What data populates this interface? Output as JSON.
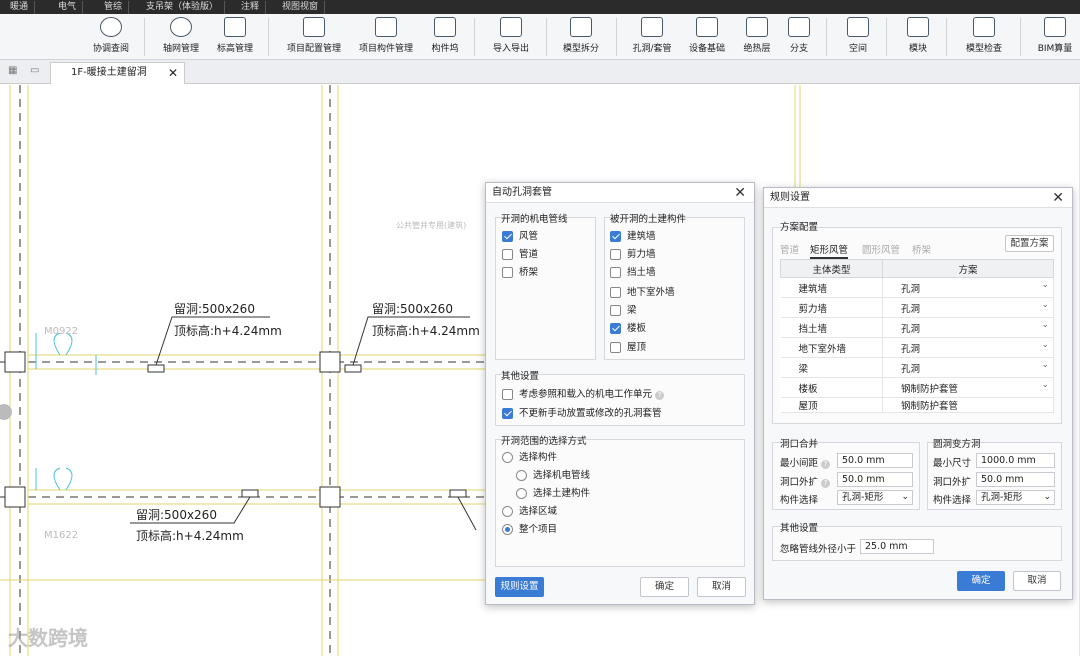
{
  "ribbon_tabs": [
    "暖通",
    "电气",
    "管综",
    "支吊架（体验版）",
    "注释",
    "视图视窗"
  ],
  "toolbar": [
    {
      "label": "协调查阅",
      "icon": "magnifier-icon"
    },
    {
      "label": "轴网管理",
      "icon": "axis-circle-icon"
    },
    {
      "label": "标高管理",
      "icon": "elevation-icon"
    },
    {
      "label": "项目配置管理",
      "icon": "project-config-icon"
    },
    {
      "label": "项目构件管理",
      "icon": "component-manage-icon"
    },
    {
      "label": "构件坞",
      "icon": "component-dock-icon"
    },
    {
      "label": "导入导出",
      "icon": "cad-import-icon"
    },
    {
      "label": "模型拆分",
      "icon": "model-split-icon"
    },
    {
      "label": "孔洞/套管",
      "icon": "hole-sleeve-icon"
    },
    {
      "label": "设备基础",
      "icon": "equipment-base-icon"
    },
    {
      "label": "绝热层",
      "icon": "insulation-icon"
    },
    {
      "label": "分支",
      "icon": "branch-icon"
    },
    {
      "label": "空间",
      "icon": "space-icon"
    },
    {
      "label": "模块",
      "icon": "module-icon"
    },
    {
      "label": "模型检查",
      "icon": "model-check-icon"
    },
    {
      "label": "BIM算量",
      "icon": "bim-quantity-icon"
    }
  ],
  "document_tab": {
    "title": "1F-暖接土建留洞",
    "close": "✕"
  },
  "canvas": {
    "labels": [
      {
        "hole": "留洞:500x260",
        "elev": "顶标高:h+4.24mm"
      },
      {
        "hole": "留洞:500x260",
        "elev": "顶标高:h+4.24mm"
      },
      {
        "hole": "留洞:500x260",
        "elev": "顶标高:h+4.24mm"
      }
    ],
    "door_tags": [
      "M0922",
      "M1622"
    ],
    "ghost_text": "公共管井专用(建筑)"
  },
  "dialog1": {
    "title": "自动孔洞套管",
    "mep_group": "开洞的机电管线",
    "mep_items": [
      {
        "label": "风管",
        "checked": true
      },
      {
        "label": "管道",
        "checked": false
      },
      {
        "label": "桥架",
        "checked": false
      }
    ],
    "civil_group": "被开洞的土建构件",
    "civil_items": [
      {
        "label": "建筑墙",
        "checked": true
      },
      {
        "label": "剪力墙",
        "checked": false
      },
      {
        "label": "挡土墙",
        "checked": false
      },
      {
        "label": "地下室外墙",
        "checked": false
      },
      {
        "label": "梁",
        "checked": false
      },
      {
        "label": "楼板",
        "checked": true
      },
      {
        "label": "屋顶",
        "checked": false
      }
    ],
    "other_group": "其他设置",
    "other_items": [
      {
        "label": "考虑参照和载入的机电工作单元",
        "checked": false,
        "help": true
      },
      {
        "label": "不更新手动放置或修改的孔洞套管",
        "checked": true,
        "help": false
      }
    ],
    "range_group": "开洞范围的选择方式",
    "range_items": [
      {
        "label": "选择构件",
        "checked": false,
        "indent": 0
      },
      {
        "label": "选择机电管线",
        "checked": false,
        "indent": 1
      },
      {
        "label": "选择土建构件",
        "checked": false,
        "indent": 1
      },
      {
        "label": "选择区域",
        "checked": false,
        "indent": 0
      },
      {
        "label": "整个项目",
        "checked": true,
        "indent": 0
      }
    ],
    "btn_rules": "规则设置",
    "btn_ok": "确定",
    "btn_cancel": "取消"
  },
  "dialog2": {
    "title": "规则设置",
    "scheme_group": "方案配置",
    "subtabs": [
      {
        "label": "管道",
        "active": false
      },
      {
        "label": "矩形风管",
        "active": true
      },
      {
        "label": "圆形风管",
        "active": false
      },
      {
        "label": "桥架",
        "active": false
      }
    ],
    "btn_config": "配置方案",
    "table_headers": [
      "主体类型",
      "方案"
    ],
    "rows": [
      [
        "建筑墙",
        "孔洞"
      ],
      [
        "剪力墙",
        "孔洞"
      ],
      [
        "挡土墙",
        "孔洞"
      ],
      [
        "地下室外墙",
        "孔洞"
      ],
      [
        "梁",
        "孔洞"
      ],
      [
        "楼板",
        "钢制防护套管"
      ],
      [
        "屋顶",
        "钢制防护套管"
      ]
    ],
    "merge_group": "洞口合并",
    "merge_fields": [
      {
        "label": "最小间距",
        "value": "50.0 mm",
        "help": true
      },
      {
        "label": "洞口外扩",
        "value": "50.0 mm",
        "help": true
      },
      {
        "label": "构件选择",
        "value": "孔洞-矩形",
        "help": false
      }
    ],
    "round_group": "圆洞变方洞",
    "round_fields": [
      {
        "label": "最小尺寸",
        "value": "1000.0 mm"
      },
      {
        "label": "洞口外扩",
        "value": "50.0 mm"
      },
      {
        "label": "构件选择",
        "value": "孔洞-矩形"
      }
    ],
    "other_group": "其他设置",
    "ignore_label": "忽略管线外径小于",
    "ignore_value": "25.0 mm",
    "btn_ok": "确定",
    "btn_cancel": "取消"
  },
  "watermark": "大数跨境",
  "colors": {
    "accent": "#3a7bd5",
    "ribbon_bg": "#2b2b2b"
  }
}
